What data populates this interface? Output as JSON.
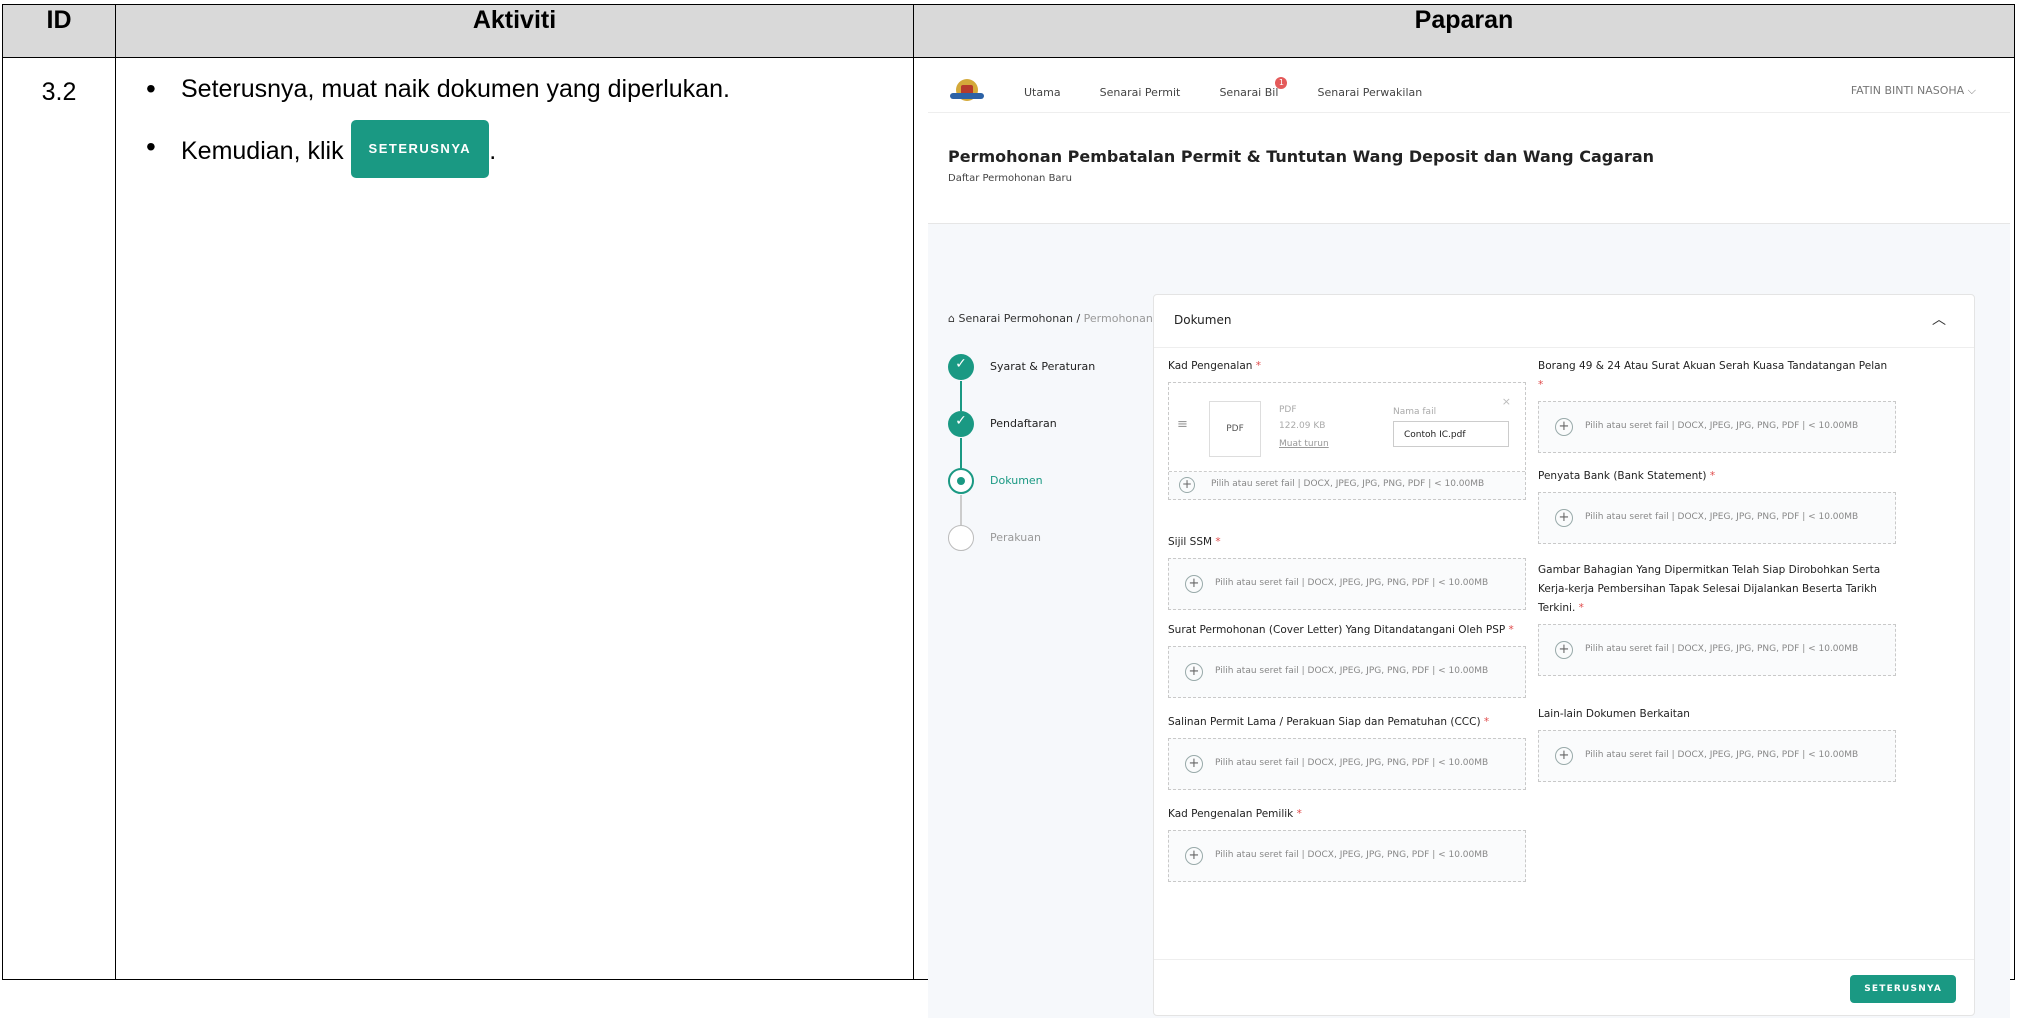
{
  "table": {
    "headers": {
      "id": "ID",
      "activity": "Aktiviti",
      "display": "Paparan"
    },
    "row": {
      "id": "3.2",
      "steps": [
        {
          "text": "Seterusnya, muat naik dokumen yang diperlukan."
        },
        {
          "text": "Kemudian, klik",
          "button": "SETERUSNYA",
          "suffix": "."
        }
      ]
    }
  },
  "ui": {
    "nav": [
      "Utama",
      "Senarai Permit",
      "Senarai Bil",
      "Senarai Perwakilan"
    ],
    "nav_badge": "1",
    "user": "FATIN BINTI NASOHA ⌵",
    "page_title": "Permohonan Pembatalan Permit & Tuntutan Wang Deposit dan Wang Cagaran",
    "page_subtitle": "Daftar Permohonan Baru",
    "breadcrumb": {
      "first": "Senarai Permohonan",
      "sep": "/",
      "current": "Permohonan Baru"
    },
    "steps": [
      "Syarat & Peraturan",
      "Pendaftaran",
      "Dokumen",
      "Perakuan"
    ],
    "card_title": "Dokumen",
    "drop_hint": "Pilih atau seret fail | DOCX, JPEG, JPG, PNG, PDF | < 10.00MB",
    "uploaded": {
      "thumb": "PDF",
      "type": "PDF",
      "size": "122.09 KB",
      "download": "Muat turun",
      "name_label": "Nama fail",
      "name_value": "Contoh IC.pdf"
    },
    "fields_left": [
      "Kad Pengenalan",
      "Sijil SSM",
      "Surat Permohonan (Cover Letter) Yang Ditandatangani Oleh PSP",
      "Salinan Permit Lama / Perakuan Siap dan Pematuhan (CCC)",
      "Kad Pengenalan Pemilik"
    ],
    "fields_right": [
      "Borang 49 & 24 Atau Surat Akuan Serah Kuasa Tandatangan Pelan",
      "Penyata Bank (Bank Statement)",
      "Gambar Bahagian Yang Dipermitkan Telah Siap Dirobohkan Serta Kerja-kerja Pembersihan Tapak Selesai Dijalankan Beserta Tarikh Terkini.",
      "Lain-lain Dokumen Berkaitan"
    ],
    "required_mark": "*",
    "next_button": "SETERUSNYA",
    "colors": {
      "accent": "#1a9983",
      "required": "#e04a4a",
      "header_bg": "#d9d9d9"
    }
  }
}
